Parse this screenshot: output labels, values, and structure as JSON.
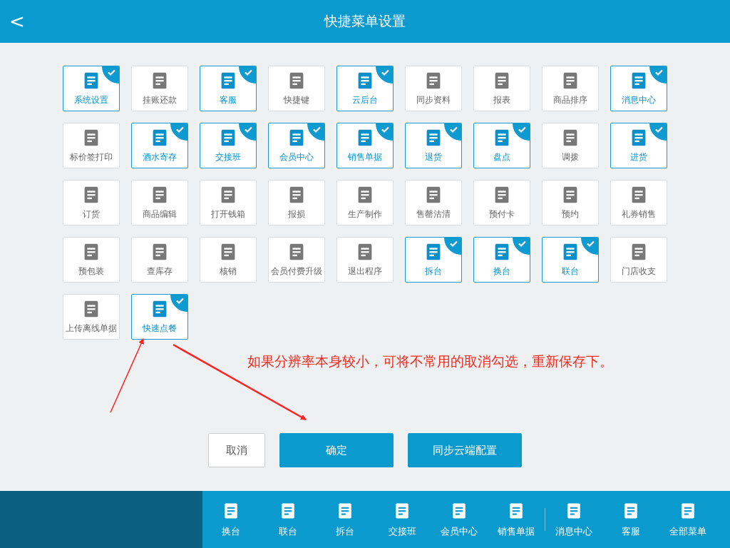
{
  "header": {
    "back": "<",
    "title": "快捷菜单设置"
  },
  "tiles": [
    {
      "label": "系统设置",
      "selected": true
    },
    {
      "label": "挂账还款",
      "selected": false
    },
    {
      "label": "客服",
      "selected": true
    },
    {
      "label": "快捷键",
      "selected": false
    },
    {
      "label": "云后台",
      "selected": true
    },
    {
      "label": "同步资料",
      "selected": false
    },
    {
      "label": "报表",
      "selected": false
    },
    {
      "label": "商品排序",
      "selected": false
    },
    {
      "label": "消息中心",
      "selected": true
    },
    {
      "label": "标价签打印",
      "selected": false
    },
    {
      "label": "酒水寄存",
      "selected": true
    },
    {
      "label": "交接班",
      "selected": true
    },
    {
      "label": "会员中心",
      "selected": true
    },
    {
      "label": "销售单据",
      "selected": true
    },
    {
      "label": "退货",
      "selected": true
    },
    {
      "label": "盘点",
      "selected": true
    },
    {
      "label": "调拨",
      "selected": false
    },
    {
      "label": "进货",
      "selected": true
    },
    {
      "label": "订货",
      "selected": false
    },
    {
      "label": "商品编辑",
      "selected": false
    },
    {
      "label": "打开钱箱",
      "selected": false
    },
    {
      "label": "报损",
      "selected": false
    },
    {
      "label": "生产制作",
      "selected": false
    },
    {
      "label": "售罄沽清",
      "selected": false
    },
    {
      "label": "预付卡",
      "selected": false
    },
    {
      "label": "预约",
      "selected": false
    },
    {
      "label": "礼券销售",
      "selected": false
    },
    {
      "label": "预包装",
      "selected": false
    },
    {
      "label": "查库存",
      "selected": false
    },
    {
      "label": "核销",
      "selected": false
    },
    {
      "label": "会员付费升级",
      "selected": false
    },
    {
      "label": "退出程序",
      "selected": false
    },
    {
      "label": "拆台",
      "selected": true
    },
    {
      "label": "换台",
      "selected": true
    },
    {
      "label": "联台",
      "selected": true
    },
    {
      "label": "门店收支",
      "selected": false
    },
    {
      "label": "上传离线单据",
      "selected": false
    },
    {
      "label": "快速点餐",
      "selected": true
    }
  ],
  "note": "如果分辨率本身较小，可将不常用的取消勾选，重新保存下。",
  "buttons": [
    {
      "label": "取消",
      "kind": "secondary"
    },
    {
      "label": "确定",
      "kind": "primary"
    },
    {
      "label": "同步云端配置",
      "kind": "primary"
    }
  ],
  "bottom_bar": {
    "groups": [
      [
        {
          "label": "换台"
        },
        {
          "label": "联台"
        },
        {
          "label": "拆台"
        },
        {
          "label": "交接班"
        },
        {
          "label": "会员中心"
        },
        {
          "label": "销售单据"
        }
      ],
      [
        {
          "label": "消息中心"
        },
        {
          "label": "客服"
        },
        {
          "label": "全部菜单"
        }
      ]
    ]
  }
}
